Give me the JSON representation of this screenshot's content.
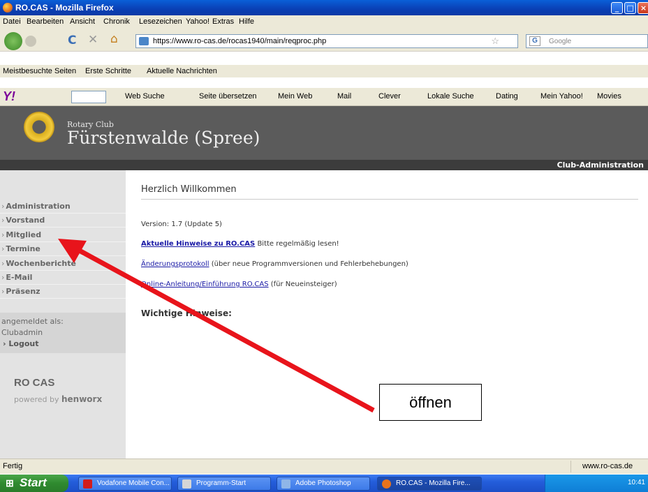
{
  "window": {
    "title": "RO.CAS - Mozilla Firefox"
  },
  "menubar": [
    "Datei",
    "Bearbeiten",
    "Ansicht",
    "Chronik",
    "Lesezeichen",
    "Yahoo!",
    "Extras",
    "Hilfe"
  ],
  "navbar": {
    "url": "https://www.ro-cas.de/rocas1940/main/reqproc.php",
    "search_placeholder": "Google"
  },
  "bookmarks": [
    "Meistbesuchte Seiten",
    "Erste Schritte",
    "Aktuelle Nachrichten"
  ],
  "yahoo_toolbar": [
    "Web Suche",
    "Seite übersetzen",
    "Mein Web",
    "Mail",
    "Clever",
    "Lokale Suche",
    "Dating",
    "Mein Yahoo!",
    "Movies"
  ],
  "header": {
    "club_small": "Rotary Club",
    "club_name": "Fürstenwalde (Spree)",
    "admin_label": "Club-Administration"
  },
  "sidebar": {
    "items": [
      "Administration",
      "Vorstand",
      "Mitglied",
      "Termine",
      "Wochenberichte",
      "E-Mail",
      "Präsenz"
    ],
    "logged_in_label": "angemeldet als:",
    "username": "Clubadmin",
    "logout": "Logout",
    "brand": "RO CAS",
    "powered_by": "powered by",
    "powered_brand": "henworx"
  },
  "main": {
    "welcome": "Herzlich Willkommen",
    "version": "Version: 1.7 (Update 5)",
    "hinweise_link": "Aktuelle Hinweise zu RO.CAS",
    "hinweise_text": " Bitte regelmäßig lesen!",
    "changelog_link": "Änderungsprotokoll",
    "changelog_text": " (über neue Programmversionen und Fehlerbehebungen)",
    "manual_link": "Online-Anleitung/Einführung RO.CAS",
    "manual_text": " (für Neueinsteiger)",
    "important": "Wichtige Hinweise:"
  },
  "annotation": {
    "text": "öffnen",
    "color": "#e8141b"
  },
  "statusbar": {
    "status": "Fertig",
    "host": "www.ro-cas.de"
  },
  "taskbar": {
    "start": "Start",
    "tasks": [
      "Vodafone Mobile Con...",
      "Programm-Start",
      "Adobe Photoshop",
      "RO.CAS - Mozilla Fire..."
    ],
    "clock": "10:41"
  }
}
